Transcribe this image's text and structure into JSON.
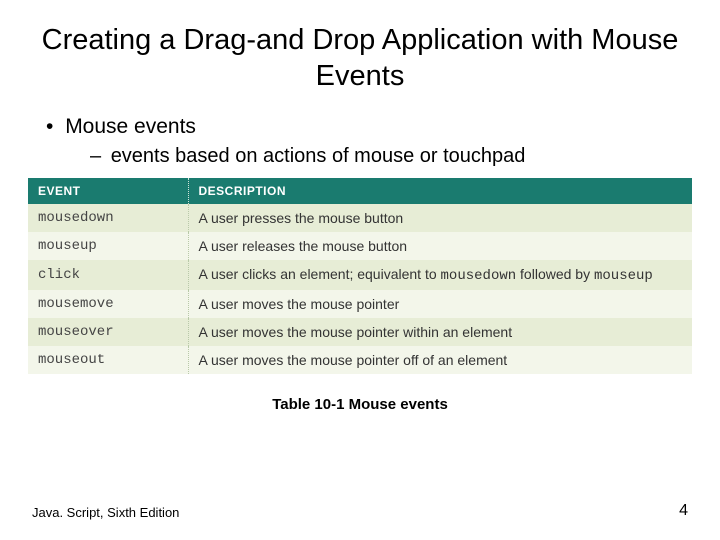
{
  "title": "Creating a Drag-and Drop Application with Mouse Events",
  "bullet_l1": "Mouse events",
  "bullet_l2": "events based on actions of mouse or touchpad",
  "table": {
    "headers": {
      "event": "EVENT",
      "description": "DESCRIPTION"
    },
    "rows": [
      {
        "event": "mousedown",
        "desc_pre": "A user presses the mouse button",
        "desc_mono": "",
        "desc_post": ""
      },
      {
        "event": "mouseup",
        "desc_pre": "A user releases the mouse button",
        "desc_mono": "",
        "desc_post": ""
      },
      {
        "event": "click",
        "desc_pre": "A user clicks an element; equivalent to ",
        "desc_mono": "mousedown",
        "desc_mid": " followed by ",
        "desc_mono2": "mouseup",
        "desc_post": ""
      },
      {
        "event": "mousemove",
        "desc_pre": "A user moves the mouse pointer",
        "desc_mono": "",
        "desc_post": ""
      },
      {
        "event": "mouseover",
        "desc_pre": "A user moves the mouse pointer within an element",
        "desc_mono": "",
        "desc_post": ""
      },
      {
        "event": "mouseout",
        "desc_pre": "A user moves the mouse pointer off of an element",
        "desc_mono": "",
        "desc_post": ""
      }
    ]
  },
  "caption": "Table 10-1 Mouse events",
  "footer_left": "Java. Script, Sixth Edition",
  "footer_right": "4"
}
